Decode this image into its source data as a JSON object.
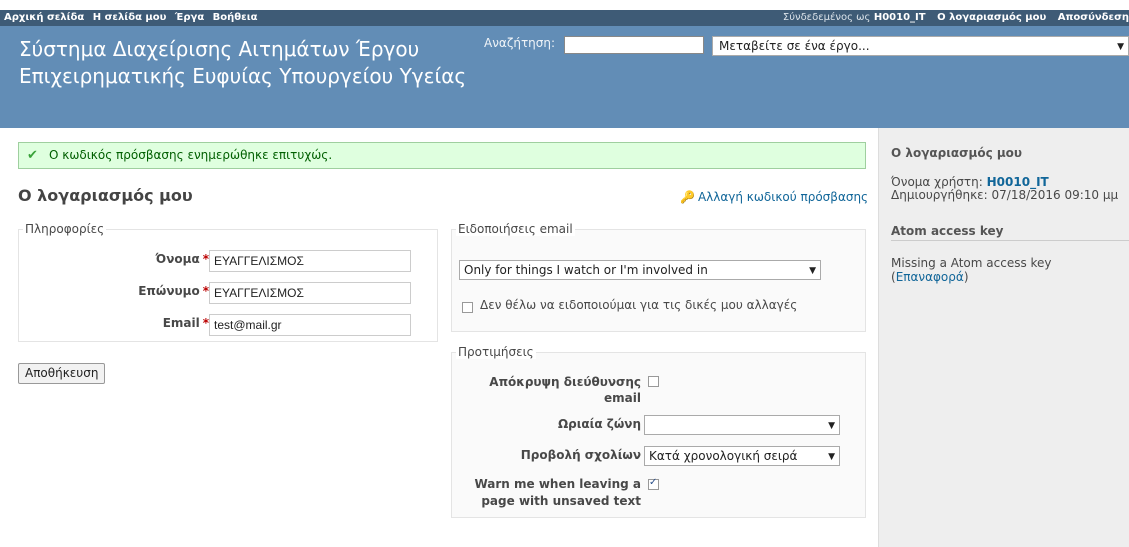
{
  "top_menu": {
    "items": [
      "Αρχική σελίδα",
      "Η σελίδα μου",
      "Έργα",
      "Βοήθεια"
    ],
    "logged_as_label": "Σύνδεδεμένος ως",
    "logged_user": "H0010_IT",
    "account_link": "Ο λογαριασμός μου",
    "logout_link": "Αποσύνδεση"
  },
  "header": {
    "title": "Σύστημα Διαχείρισης Αιτημάτων Έργου Επιχειρηματικής Ευφυίας Υπουργείου Υγείας",
    "search_label": "Αναζήτηση:",
    "search_value": "",
    "project_jump": "Μεταβείτε σε ένα έργο..."
  },
  "flash": {
    "message": "Ο κωδικός πρόσβασης ενημερώθηκε επιτυχώς."
  },
  "page": {
    "title": "Ο λογαριασμός μου",
    "change_password": "Αλλαγή κωδικού πρόσβασης"
  },
  "info_section": {
    "legend": "Πληροφορίες",
    "firstname_label": "Όνομα",
    "firstname_value": "ΕΥΑΓΓΕΛΙΣΜΟΣ",
    "lastname_label": "Επώνυμο",
    "lastname_value": "ΕΥΑΓΓΕΛΙΣΜΟΣ",
    "email_label": "Email",
    "email_value": "test@mail.gr",
    "required_mark": "*"
  },
  "save_button": "Αποθήκευση",
  "email_notifications": {
    "legend": "Ειδοποιήσεις email",
    "selected_option": "Only for things I watch or I'm involved in",
    "no_self_notified_label": "Δεν θέλω να ειδοποιούμαι για τις δικές μου αλλαγές",
    "no_self_notified_checked": false
  },
  "preferences": {
    "legend": "Προτιμήσεις",
    "hide_mail_label_line1": "Απόκρυψη διεύθυνσης",
    "hide_mail_label_line2": "email",
    "hide_mail_checked": false,
    "timezone_label": "Ωριαία ζώνη",
    "timezone_value": "",
    "comments_label": "Προβολή σχολίων",
    "comments_value": "Κατά χρονολογική σειρά",
    "warn_label_line1": "Warn me when leaving a",
    "warn_label_line2": "page with unsaved text",
    "warn_checked": true
  },
  "sidebar": {
    "account_title": "Ο λογαριασμός μου",
    "username_label": "Όνομα χρήστη:",
    "username_value": "H0010_IT",
    "created_label": "Δημιουργήθηκε:",
    "created_value": "07/18/2016 09:10 μμ",
    "atom_title": "Atom access key",
    "atom_missing": "Missing a Atom access key",
    "atom_reset": "Επαναφορά"
  },
  "colors": {
    "header_bg": "#628DB6",
    "top_menu_bg": "#3E5B76",
    "link": "#116699",
    "flash_bg": "#DFFFDF",
    "required": "#BB0000",
    "sidebar_bg": "#EEEEEE"
  },
  "icons": {
    "flash": "check-icon",
    "change_password": "key-icon",
    "dropdown": "chevron-down-icon"
  }
}
